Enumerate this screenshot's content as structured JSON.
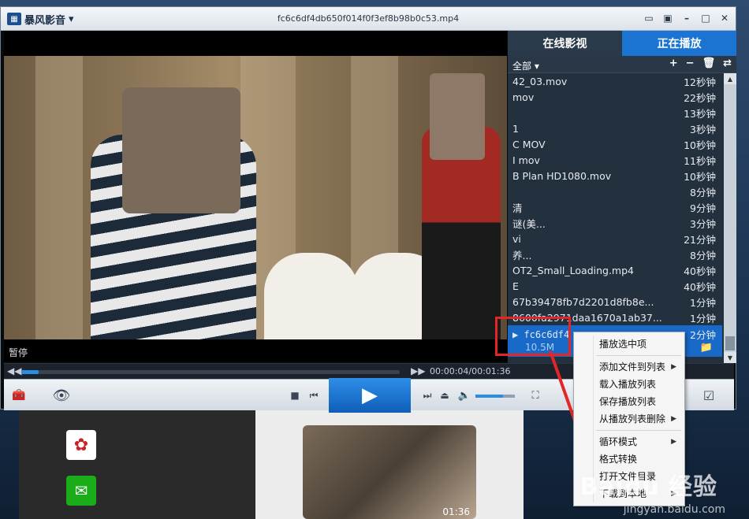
{
  "window": {
    "app_name": "暴风影音",
    "title": "fc6c6df4db650f014f0f3ef8b98b0c53.mp4"
  },
  "player": {
    "status": "暂停",
    "current_time": "00:00:04",
    "total_time": "00:01:36",
    "time_display": "00:00:04/00:01:36",
    "progress_fraction": 0.045,
    "volume_fraction": 0.7
  },
  "sidebar": {
    "tabs": [
      {
        "label": "在线影视",
        "active": false
      },
      {
        "label": "正在播放",
        "active": true
      }
    ],
    "filter_label": "全部 ▾",
    "toolbar_icons": [
      "plus-icon",
      "minus-icon",
      "trash-icon",
      "loop-icon"
    ],
    "items": [
      {
        "name": "42_03.mov",
        "duration": "12秒钟"
      },
      {
        "name": "mov",
        "duration": "22秒钟"
      },
      {
        "name": "",
        "duration": "13秒钟"
      },
      {
        "name": "1",
        "duration": "3秒钟"
      },
      {
        "name": "C        MOV",
        "duration": "10秒钟"
      },
      {
        "name": "I        mov",
        "duration": "11秒钟"
      },
      {
        "name": "B      Plan HD1080.mov",
        "duration": "10秒钟"
      },
      {
        "name": "",
        "duration": "8分钟"
      },
      {
        "name": "清",
        "duration": "9分钟"
      },
      {
        "name": "         谜(美...",
        "duration": "3分钟"
      },
      {
        "name": "           vi",
        "duration": "21分钟"
      },
      {
        "name": "         养...",
        "duration": "8分钟"
      },
      {
        "name": "      OT2_Small_Loading.mp4",
        "duration": "40秒钟"
      },
      {
        "name": "E",
        "duration": "40秒钟"
      },
      {
        "name": "67b39478fb7d2201d8fb8e...",
        "duration": "1分钟"
      },
      {
        "name": "8600fa2971daa1670a1ab37...",
        "duration": "1分钟"
      }
    ],
    "selected_item": {
      "name": "fc6c6df4",
      "duration": "2分钟",
      "size": "10.5M"
    }
  },
  "context_menu": {
    "items": [
      {
        "label": "播放选中项",
        "submenu": false
      },
      {
        "sep": true
      },
      {
        "label": "添加文件到列表",
        "submenu": true
      },
      {
        "label": "载入播放列表",
        "submenu": false
      },
      {
        "label": "保存播放列表",
        "submenu": false
      },
      {
        "label": "从播放列表删除",
        "submenu": true
      },
      {
        "sep": true
      },
      {
        "label": "循环模式",
        "submenu": true
      },
      {
        "label": "格式转换",
        "submenu": false
      },
      {
        "label": "打开文件目录",
        "submenu": false
      },
      {
        "label": "下载到本地",
        "submenu": true
      }
    ]
  },
  "background": {
    "thumb_time": "01:36",
    "watermark": "Baidu 经验",
    "watermark_sub": "jingyan.baidu.com"
  },
  "colors": {
    "accent": "#1b74d2",
    "annotation": "#e32626",
    "sidebar_bg": "#23303e"
  }
}
